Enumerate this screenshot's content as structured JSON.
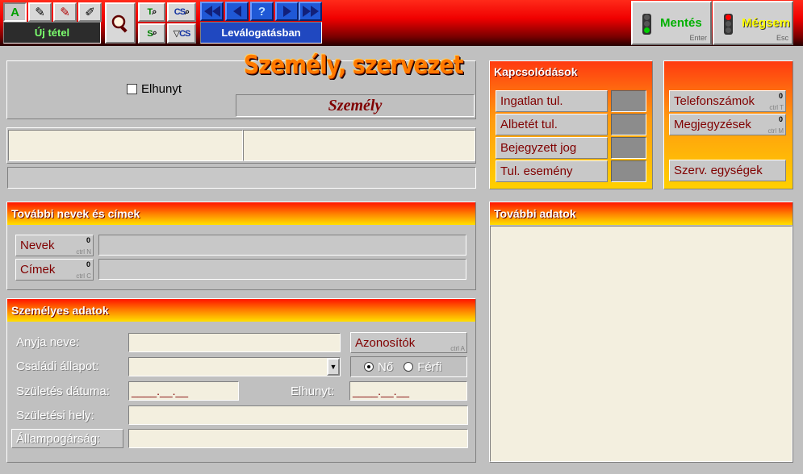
{
  "toolbar": {
    "edit_tools": [
      {
        "name": "text-a-icon",
        "glyph": "A",
        "color": "#00a000"
      },
      {
        "name": "pencil-edit-icon",
        "glyph": "✎",
        "color": "#000000"
      },
      {
        "name": "pencil-red-icon",
        "glyph": "✎",
        "color": "#b00000"
      },
      {
        "name": "eraser-icon",
        "glyph": "✐",
        "color": "#000000"
      }
    ],
    "new_item_label": "Új tétel",
    "search_icons": [
      "magnifier-icon",
      "find-text-icon",
      "find-cs-icon",
      "find-s-icon",
      "filter-cs-icon"
    ],
    "nav_icons": [
      "first-record-icon",
      "prev-record-icon",
      "help-icon",
      "next-record-icon",
      "last-record-icon"
    ],
    "filter_status": "Leválogatásban",
    "help_glyph": "?",
    "save": {
      "label": "Mentés",
      "key": "Enter",
      "color": "#00b000"
    },
    "cancel": {
      "label": "Mégsem",
      "key": "Esc",
      "color": "#ffff00"
    }
  },
  "header": {
    "deceased_label": "Elhunyt",
    "logo_title": "Személy, szervezet",
    "type_label": "Személy"
  },
  "related": {
    "title": "Kapcsolódások",
    "items": [
      {
        "label": "Ingatlan tul."
      },
      {
        "label": "Albetét tul."
      },
      {
        "label": "Bejegyzett jog"
      },
      {
        "label": "Tul. esemény"
      }
    ]
  },
  "contact": {
    "phones": {
      "label": "Telefonszámok",
      "count": "0",
      "key": "ctrl T"
    },
    "notes": {
      "label": "Megjegyzések",
      "count": "0",
      "key": "ctrl M"
    },
    "org_units": {
      "label": "Szerv. egységek"
    }
  },
  "names_section": {
    "title": "További nevek és címek",
    "names": {
      "label": "Nevek",
      "count": "0",
      "key": "ctrl N"
    },
    "addresses": {
      "label": "Címek",
      "count": "0",
      "key": "ctrl C"
    }
  },
  "personal": {
    "title": "Személyes adatok",
    "mother_label": "Anyja neve:",
    "marital_label": "Családi állapot:",
    "birth_date_label": "Születés dátuma:",
    "birth_date_value": "____.__.__",
    "deceased_label": "Elhunyt:",
    "deceased_value": "____.__.__",
    "birth_place_label": "Születési hely:",
    "citizenship_label": "Állampogárság:",
    "ids": {
      "label": "Azonosítók",
      "key": "ctrl A"
    },
    "gender": {
      "female": "Nő",
      "male": "Férfi",
      "selected": "female"
    },
    "dropdown_glyph": "▼"
  },
  "extra": {
    "title": "További adatok"
  }
}
